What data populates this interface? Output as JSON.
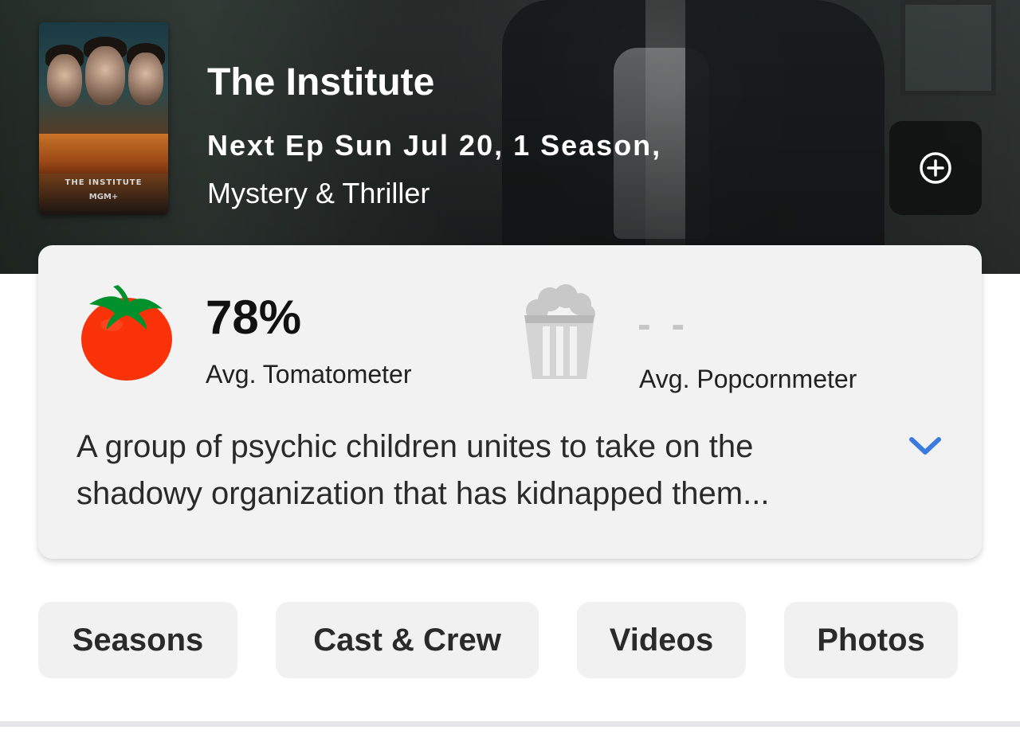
{
  "show": {
    "title": "The Institute",
    "meta": "Next Ep Sun Jul 20, 1 Season,",
    "genre": "Mystery & Thriller",
    "poster_title": "THE INSTITUTE",
    "poster_brand": "MGM+"
  },
  "actions": {
    "add_icon": "plus-circle-icon"
  },
  "scores": {
    "tomatometer_value": "78%",
    "tomatometer_label": "Avg. Tomatometer",
    "tomatometer_icon": "tomato-icon",
    "popcornmeter_value": "- -",
    "popcornmeter_label": "Avg. Popcornmeter",
    "popcornmeter_icon": "popcorn-bucket-icon"
  },
  "synopsis": "A group of psychic children unites to take on the shadowy organization that has kidnapped them...",
  "tabs": [
    {
      "label": "Seasons"
    },
    {
      "label": "Cast & Crew"
    },
    {
      "label": "Videos"
    },
    {
      "label": "Photos"
    }
  ],
  "colors": {
    "tomato_red": "#FA320A",
    "tomato_green": "#00912D",
    "expand_blue": "#3A7BE0",
    "popcorn_gray": "#C8C8C8"
  }
}
